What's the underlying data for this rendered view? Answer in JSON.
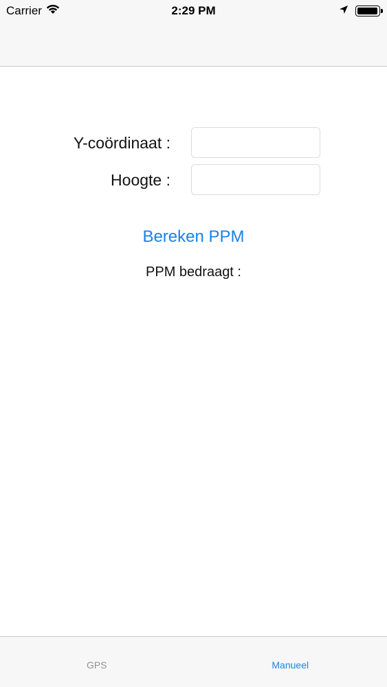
{
  "status_bar": {
    "carrier": "Carrier",
    "time": "2:29 PM",
    "battery_level": 0.95
  },
  "form": {
    "y_label": "Y-coördinaat :",
    "y_value": "",
    "height_label": "Hoogte :",
    "height_value": ""
  },
  "action": {
    "calculate_label": "Bereken PPM"
  },
  "result": {
    "label": "PPM bedraagt :"
  },
  "tabs": [
    {
      "label": "GPS",
      "active": false
    },
    {
      "label": "Manueel",
      "active": true
    }
  ],
  "colors": {
    "accent": "#1a82e6",
    "bar_background": "#f7f7f8",
    "inactive_tab": "#929292"
  }
}
